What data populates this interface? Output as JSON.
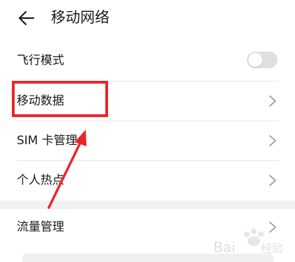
{
  "header": {
    "title": "移动网络",
    "back_icon": "arrow-left-icon"
  },
  "settings": [
    {
      "label": "飞行模式",
      "control": "toggle",
      "toggle_on": false
    },
    {
      "label": "移动数据",
      "control": "chevron"
    },
    {
      "label": "SIM 卡管理",
      "control": "chevron"
    },
    {
      "label": "个人热点",
      "control": "chevron"
    },
    {
      "label": "流量管理",
      "control": "chevron"
    }
  ],
  "annotation": {
    "highlight_color": "#e8262a",
    "highlighted_item": "移动数据"
  },
  "watermark": {
    "text": "Baidu 经验"
  }
}
